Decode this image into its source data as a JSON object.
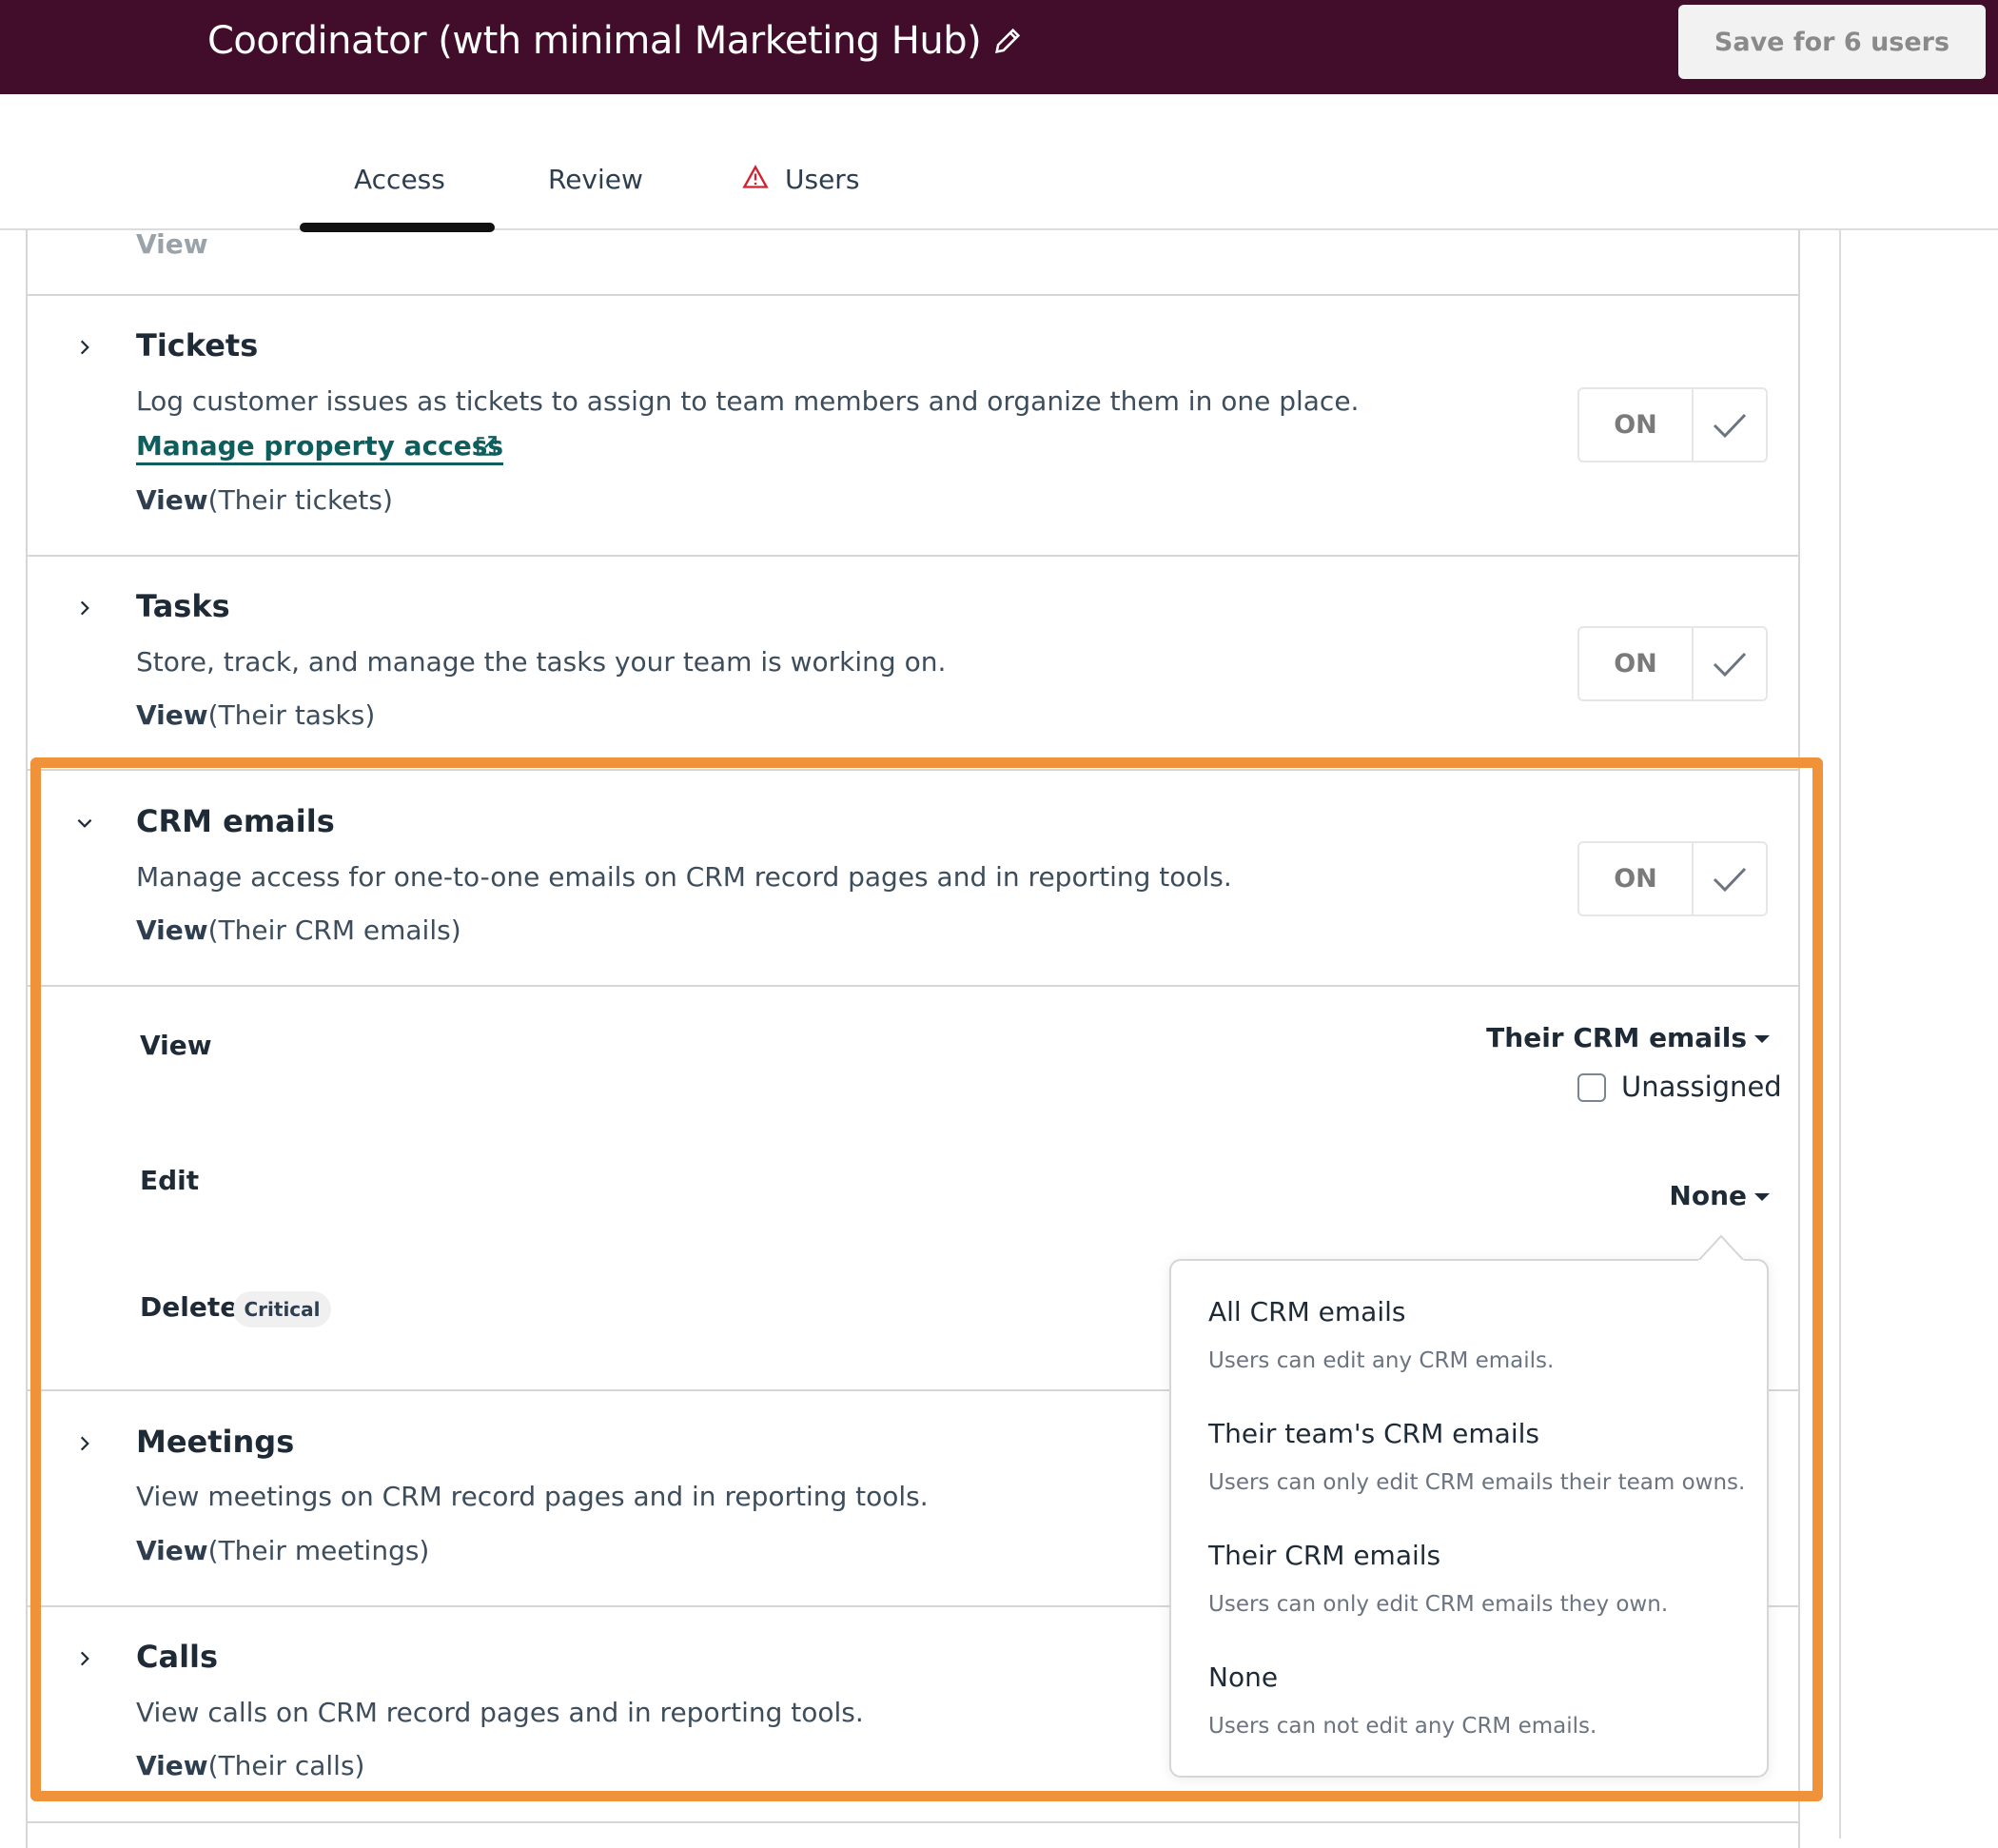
{
  "header": {
    "title": "Coordinator (wth minimal Marketing Hub)",
    "save_label": "Save for 6 users"
  },
  "tabs": [
    {
      "label": "Access"
    },
    {
      "label": "Review"
    },
    {
      "label": "Users"
    }
  ],
  "top_fade_text": "View",
  "sections": {
    "tickets": {
      "title": "Tickets",
      "desc": "Log customer issues as tickets to assign to team members and organize them in one place.",
      "link": "Manage property access",
      "view_label": "View",
      "view_value": "(Their tickets)",
      "toggle": "ON"
    },
    "tasks": {
      "title": "Tasks",
      "desc": "Store, track, and manage the tasks your team is working on.",
      "view_label": "View",
      "view_value": "(Their tasks)",
      "toggle": "ON"
    },
    "crm": {
      "title": "CRM emails",
      "desc": "Manage access for one-to-one emails on CRM record pages and in reporting tools.",
      "view_label": "View",
      "view_value": "(Their CRM emails)",
      "toggle": "ON",
      "perms": {
        "view": "View",
        "view_value": "Their CRM emails",
        "unassigned": "Unassigned",
        "edit": "Edit",
        "edit_value": "None",
        "delete": "Delete",
        "critical": "Critical"
      }
    },
    "meetings": {
      "title": "Meetings",
      "desc": "View meetings on CRM record pages and in reporting tools.",
      "view_label": "View",
      "view_value": "(Their meetings)"
    },
    "calls": {
      "title": "Calls",
      "desc": "View calls on CRM record pages and in reporting tools.",
      "view_label": "View",
      "view_value": "(Their calls)"
    }
  },
  "edit_menu": [
    {
      "title": "All CRM emails",
      "desc": "Users can edit any CRM emails."
    },
    {
      "title": "Their team's CRM emails",
      "desc": "Users can only edit CRM emails their team owns."
    },
    {
      "title": "Their CRM emails",
      "desc": "Users can only edit CRM emails they own."
    },
    {
      "title": "None",
      "desc": "Users can not edit any CRM emails."
    }
  ],
  "colors": {
    "header_bg": "#420d2a",
    "highlight": "#f0923a",
    "link": "#0f5e5e",
    "warning": "#d0222f"
  }
}
